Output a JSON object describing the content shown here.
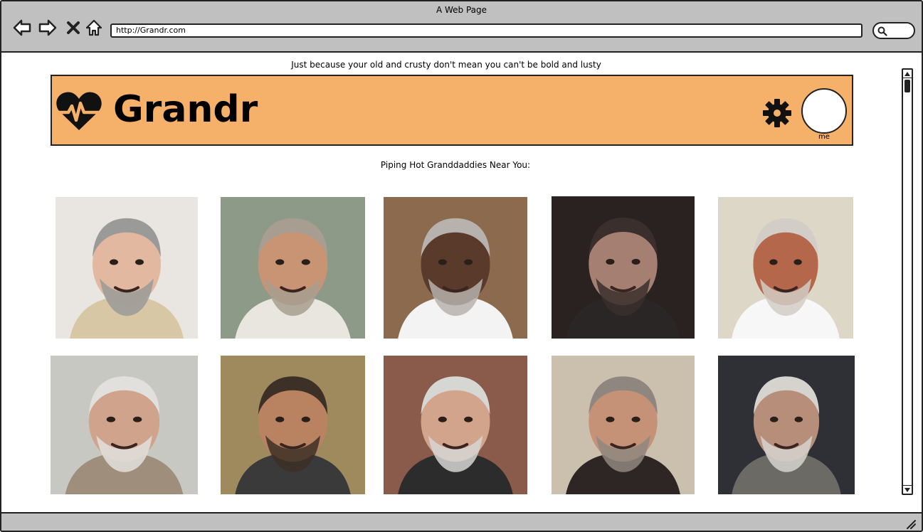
{
  "window": {
    "title": "A Web Page"
  },
  "browser": {
    "url": "http://Grandr.com"
  },
  "page": {
    "tagline": "Just because your old and crusty don't mean you can't be bold and lusty",
    "header": {
      "app_name": "Grandr",
      "profile_label": "me"
    },
    "section_title": "Piping Hot Granddaddies Near You:",
    "photos": [
      {
        "alt": "grandpa-1",
        "bg": "#e9e6e2",
        "skin": "#e3b8a0",
        "hair": "#9a9a98",
        "shirt": "#d8c7a4"
      },
      {
        "alt": "grandpa-2",
        "bg": "#8e9a88",
        "skin": "#c89474",
        "hair": "#a79e91",
        "shirt": "#e9e6df"
      },
      {
        "alt": "grandpa-3",
        "bg": "#8b6a4d",
        "skin": "#5a3a2a",
        "hair": "#b7b2ad",
        "shirt": "#f3f3f3"
      },
      {
        "alt": "grandpa-4",
        "bg": "#2a2220",
        "skin": "#a57f72",
        "hair": "#3a2f2c",
        "shirt": "#2b2626"
      },
      {
        "alt": "grandpa-5",
        "bg": "#ddd7c8",
        "skin": "#b4674b",
        "hair": "#d2cdc6",
        "shirt": "#f7f7f7"
      },
      {
        "alt": "grandpa-6",
        "bg": "#c7c8c1",
        "skin": "#d0a48c",
        "hair": "#e2e0dd",
        "shirt": "#9e8e7b"
      },
      {
        "alt": "grandpa-7",
        "bg": "#9f8a5e",
        "skin": "#b98261",
        "hair": "#3d3027",
        "shirt": "#3a3a3a"
      },
      {
        "alt": "grandpa-8",
        "bg": "#8a5a4a",
        "skin": "#d2a48c",
        "hair": "#d6d6d3",
        "shirt": "#2c2c2c"
      },
      {
        "alt": "grandpa-9",
        "bg": "#cbbfae",
        "skin": "#c59278",
        "hair": "#8f877f",
        "shirt": "#2e2624"
      },
      {
        "alt": "grandpa-10",
        "bg": "#2f3035",
        "skin": "#b68e79",
        "hair": "#d6d3cf",
        "shirt": "#6c6a64"
      }
    ]
  },
  "colors": {
    "header_bg": "#f5b06a",
    "chrome": "#c0c0c0"
  },
  "icons": [
    "back-arrow-icon",
    "forward-arrow-icon",
    "close-icon",
    "home-icon",
    "search-icon",
    "heart-pulse-icon",
    "gear-icon"
  ]
}
